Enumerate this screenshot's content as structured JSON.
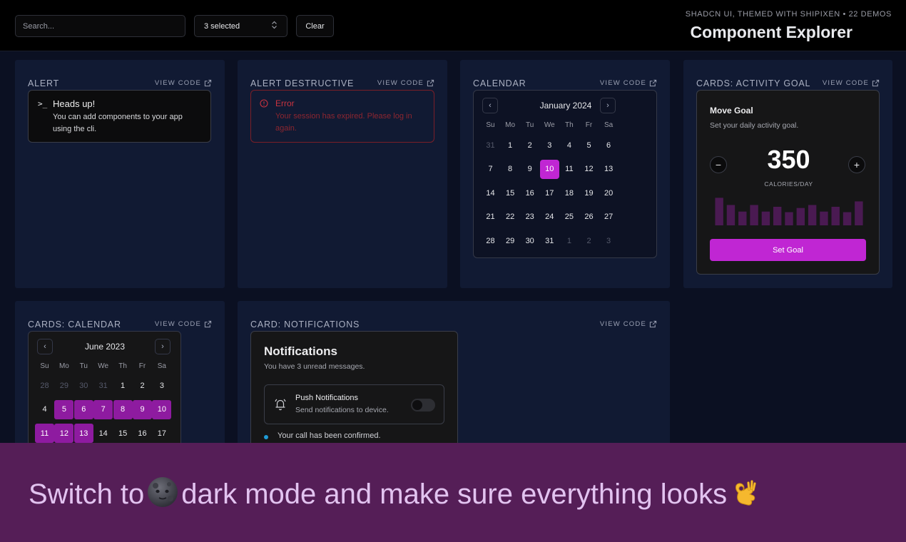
{
  "header": {
    "search_placeholder": "Search...",
    "select_label": "3 selected",
    "clear_label": "Clear",
    "subtitle": "SHADCN UI, THEMED WITH SHIPIXEN • 22 DEMOS",
    "title": "Component Explorer"
  },
  "view_code_label": "VIEW CODE",
  "panels": {
    "alert": {
      "title": "ALERT",
      "heading": "Heads up!",
      "desc": "You can add components to your app using the cli."
    },
    "alert_destructive": {
      "title": "ALERT DESTRUCTIVE",
      "heading": "Error",
      "desc": "Your session has expired. Please log in again."
    },
    "calendar": {
      "title": "CALENDAR",
      "month": "January 2024",
      "weekdays": [
        "Su",
        "Mo",
        "Tu",
        "We",
        "Th",
        "Fr",
        "Sa"
      ],
      "weeks": [
        [
          "31",
          "1",
          "2",
          "3",
          "4",
          "5",
          "6"
        ],
        [
          "7",
          "8",
          "9",
          "10",
          "11",
          "12",
          "13"
        ],
        [
          "14",
          "15",
          "16",
          "17",
          "18",
          "19",
          "20"
        ],
        [
          "21",
          "22",
          "23",
          "24",
          "25",
          "26",
          "27"
        ],
        [
          "28",
          "29",
          "30",
          "31",
          "1",
          "2",
          "3"
        ]
      ],
      "selected": "10"
    },
    "activity_goal": {
      "title": "CARDS: ACTIVITY GOAL",
      "card_title": "Move Goal",
      "card_desc": "Set your daily activity goal.",
      "value": "350",
      "unit": "CALORIES/DAY",
      "button": "Set Goal",
      "bar_values": [
        0.92,
        0.68,
        0.46,
        0.68,
        0.46,
        0.62,
        0.44,
        0.58,
        0.68,
        0.46,
        0.62,
        0.44,
        0.8
      ],
      "bar_color": "#4a1a52"
    },
    "cards_calendar": {
      "title": "CARDS: CALENDAR",
      "month": "June 2023",
      "weekdays": [
        "Su",
        "Mo",
        "Tu",
        "We",
        "Th",
        "Fr",
        "Sa"
      ],
      "weeks": [
        [
          "28",
          "29",
          "30",
          "31",
          "1",
          "2",
          "3"
        ],
        [
          "4",
          "5",
          "6",
          "7",
          "8",
          "9",
          "10"
        ],
        [
          "11",
          "12",
          "13",
          "14",
          "15",
          "16",
          "17"
        ]
      ]
    },
    "notifications": {
      "title": "CARD: NOTIFICATIONS",
      "card_title": "Notifications",
      "card_desc": "You have 3 unread messages.",
      "push_title": "Push Notifications",
      "push_desc": "Send notifications to device.",
      "message": "Your call has been confirmed."
    }
  },
  "banner": {
    "text_before": "Switch to",
    "text_after": "dark mode and make sure everything looks"
  },
  "colors": {
    "accent": "#c026d3",
    "range": "#8e1ba0",
    "destructive": "#c8333f",
    "banner_bg": "#551e57",
    "panel_bg": "#111a33"
  }
}
